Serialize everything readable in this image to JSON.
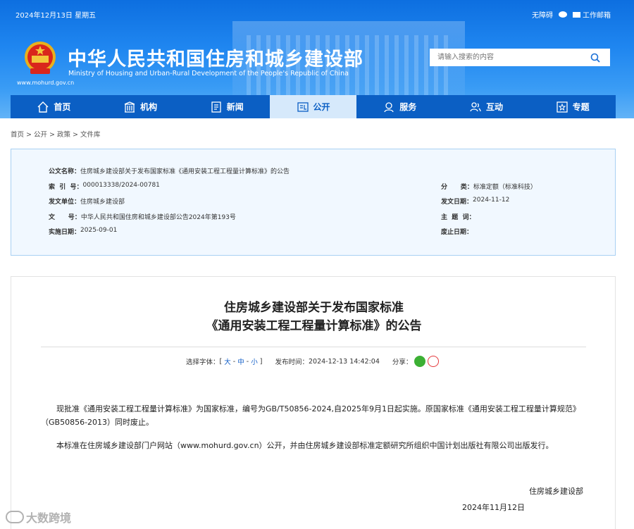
{
  "topbar": {
    "date": "2024年12月13日 星期五",
    "accessibility": "无障碍",
    "mail": "工作邮箱"
  },
  "header": {
    "title": "中华人民共和国住房和城乡建设部",
    "subtitle": "Ministry of Housing and Urban-Rural Development of the People's Republic of China",
    "url": "www.mohurd.gov.cn",
    "search_placeholder": "请输入搜索的内容"
  },
  "nav": [
    {
      "label": "首页",
      "icon": "home-icon"
    },
    {
      "label": "机构",
      "icon": "building-icon"
    },
    {
      "label": "新闻",
      "icon": "news-icon"
    },
    {
      "label": "公开",
      "icon": "open-icon"
    },
    {
      "label": "服务",
      "icon": "service-icon"
    },
    {
      "label": "互动",
      "icon": "interaction-icon"
    },
    {
      "label": "专题",
      "icon": "topic-icon"
    }
  ],
  "breadcrumb": "首页 > 公开 > 政策 > 文件库",
  "info": {
    "doc_name_k": "公文名称：",
    "doc_name_v": "住房城乡建设部关于发布国家标准《通用安装工程工程量计算标准》的公告",
    "index_k": "索  引  号：",
    "index_v": "000013338/2024-00781",
    "category_k": "分      类：",
    "category_v": "标准定额（标准科技）",
    "issuer_k": "发文单位：",
    "issuer_v": "住房城乡建设部",
    "issue_date_k": "发文日期：",
    "issue_date_v": "2024-11-12",
    "doc_no_k": "文      号：",
    "doc_no_v": "中华人民共和国住房和城乡建设部公告2024年第193号",
    "subject_k": "主  题  词：",
    "subject_v": "",
    "effective_k": "实施日期：",
    "effective_v": "2025-09-01",
    "expiry_k": "废止日期：",
    "expiry_v": ""
  },
  "article": {
    "title_line1": "住房城乡建设部关于发布国家标准",
    "title_line2": "《通用安装工程工程量计算标准》的公告",
    "font_label": "选择字体：",
    "font_open": "[ ",
    "font_large": "大",
    "font_sep1": " - ",
    "font_medium": "中",
    "font_sep2": " - ",
    "font_small": "小",
    "font_close": " ]",
    "publish_label": "发布时间：",
    "publish_time": "2024-12-13 14:42:04",
    "share_label": "分享：",
    "para1": "现批准《通用安装工程工程量计算标准》为国家标准，编号为GB/T50856-2024,自2025年9月1日起实施。原国家标准《通用安装工程工程量计算规范》（GB50856-2013）同时废止。",
    "para2": "本标准在住房城乡建设部门户网站（www.mohurd.gov.cn）公开，并由住房城乡建设部标准定额研究所组织中国计划出版社有限公司出版发行。",
    "signer": "住房城乡建设部",
    "sign_date": "2024年11月12日"
  },
  "watermark": "大数跨境",
  "colors": {
    "header_blue": "#1f86f0",
    "nav_blue": "#0b5fc4",
    "info_bg": "#f1f8ff",
    "link_blue": "#1560c8"
  }
}
